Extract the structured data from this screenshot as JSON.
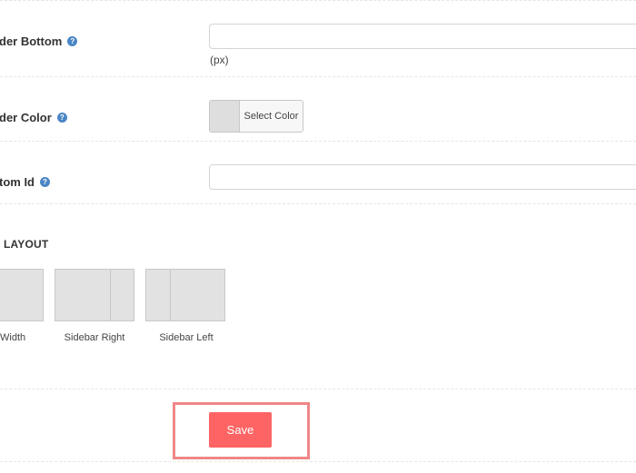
{
  "fields": {
    "border_bottom": {
      "label": "der Bottom",
      "help": "?",
      "value": "",
      "unit": "(px)"
    },
    "border_color": {
      "label": "der Color",
      "help": "?",
      "select_label": "Select Color",
      "swatch_color": "#dedede"
    },
    "custom_id": {
      "label": "tom Id",
      "help": "?",
      "value": ""
    }
  },
  "layout": {
    "title": "LAYOUT",
    "options": [
      {
        "label": "Width"
      },
      {
        "label": "Sidebar Right"
      },
      {
        "label": "Sidebar Left"
      }
    ]
  },
  "actions": {
    "save_label": "Save",
    "save_color": "#ff6464",
    "highlight_color": "#f08686"
  }
}
